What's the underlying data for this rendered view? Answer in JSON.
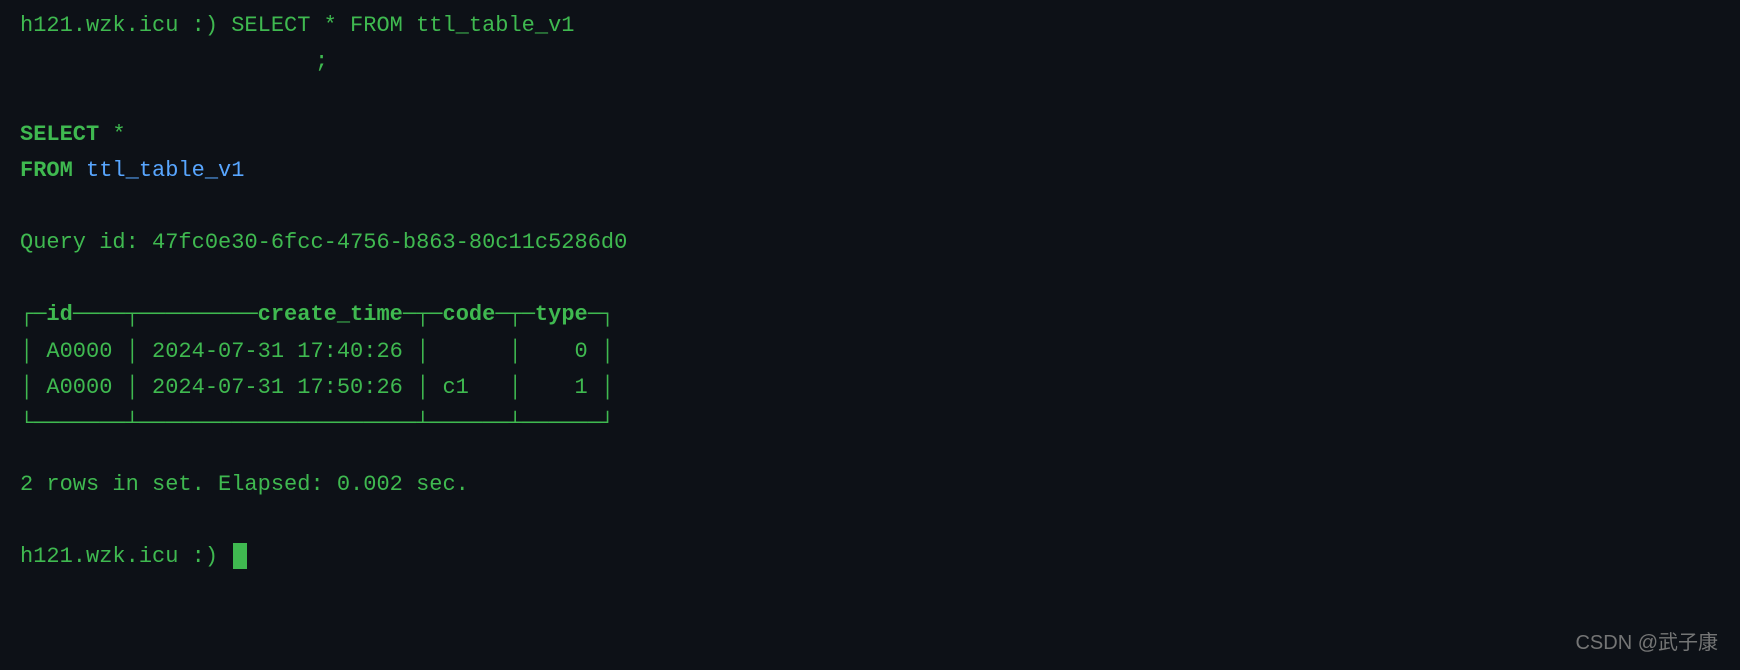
{
  "prompt_line1": "h121.wzk.icu :) SELECT * FROM ttl_table_v1",
  "prompt_line2": ";",
  "echo_select": "SELECT",
  "echo_star": " *",
  "echo_from": "FROM",
  "echo_table": " ttl_table_v1",
  "query_id_label": "Query id: ",
  "query_id": "47fc0e30-6fcc-4756-b863-80c11c5286d0",
  "table": {
    "columns": [
      "id",
      "create_time",
      "code",
      "type"
    ],
    "rows": [
      {
        "id": "A0000",
        "create_time": "2024-07-31 17:40:26",
        "code": "",
        "type": "0"
      },
      {
        "id": "A0000",
        "create_time": "2024-07-31 17:50:26",
        "code": "c1",
        "type": "1"
      }
    ]
  },
  "summary": "2 rows in set. Elapsed: 0.002 sec.",
  "prompt2": "h121.wzk.icu :) ",
  "watermark": "CSDN @武子康"
}
